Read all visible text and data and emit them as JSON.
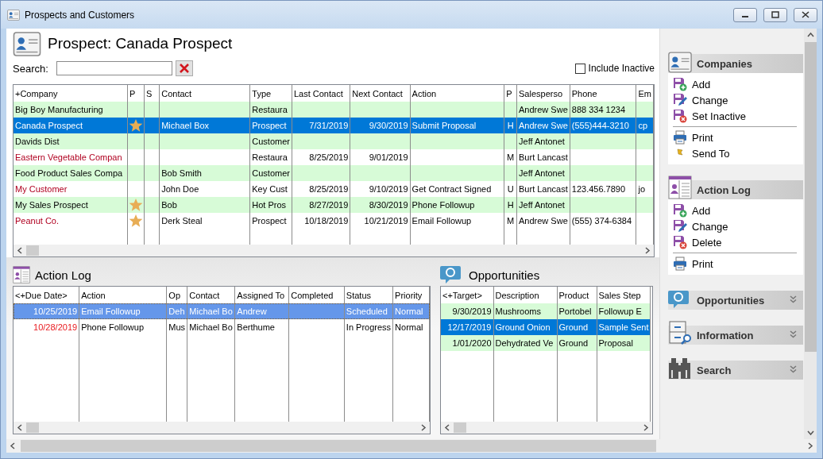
{
  "window": {
    "title": "Prospects and Customers"
  },
  "header": {
    "title": "Prospect: Canada Prospect"
  },
  "search": {
    "label": "Search:"
  },
  "include_inactive": {
    "label": "Include Inactive",
    "checked": false
  },
  "companies_grid": {
    "columns": [
      {
        "label": "+Company",
        "kind": "text"
      },
      {
        "label": "P",
        "kind": "star"
      },
      {
        "label": "S",
        "kind": "center"
      },
      {
        "label": "Contact",
        "kind": "text"
      },
      {
        "label": "Type",
        "kind": "text"
      },
      {
        "label": "Last Contact",
        "kind": "date"
      },
      {
        "label": "Next Contact",
        "kind": "date"
      },
      {
        "label": "Action",
        "kind": "text"
      },
      {
        "label": "P",
        "kind": "center"
      },
      {
        "label": "Salesperso",
        "kind": "text"
      },
      {
        "label": "Phone",
        "kind": "text"
      },
      {
        "label": "Em",
        "kind": "text"
      }
    ],
    "rows": [
      {
        "cells": [
          "Big Boy Manufacturing",
          null,
          null,
          null,
          "Restaura",
          null,
          null,
          null,
          null,
          "Andrew Swe",
          "888 334 1234",
          null
        ],
        "starred": false,
        "selected": false
      },
      {
        "cells": [
          "Canada Prospect",
          null,
          null,
          "Michael Box",
          "Prospect",
          "7/31/2019",
          "9/30/2019",
          "Submit Proposal",
          "H",
          "Andrew Swe",
          "(555)444-3210",
          "cp"
        ],
        "starred": true,
        "selected": true
      },
      {
        "cells": [
          "Davids Dist",
          null,
          null,
          null,
          "Customer",
          null,
          null,
          null,
          null,
          "Jeff Antonet",
          null,
          null
        ],
        "starred": false,
        "selected": false
      },
      {
        "cells": [
          "Eastern Vegetable Compan",
          null,
          null,
          null,
          "Restaura",
          "8/25/2019",
          "9/01/2019",
          null,
          "M",
          "Burt Lancast",
          null,
          null
        ],
        "starred": false,
        "selected": false,
        "color": "#b00020"
      },
      {
        "cells": [
          "Food Product Sales Compa",
          null,
          null,
          "Bob Smith",
          "Customer",
          null,
          null,
          null,
          null,
          "Jeff Antonet",
          null,
          null
        ],
        "starred": false,
        "selected": false
      },
      {
        "cells": [
          "My Customer",
          null,
          null,
          "John Doe",
          "Key Cust",
          "8/25/2019",
          "9/10/2019",
          "Get Contract Signed",
          "U",
          "Burt Lancast",
          "123.456.7890",
          "jo"
        ],
        "starred": false,
        "selected": false,
        "color": "#b00020"
      },
      {
        "cells": [
          "My Sales Prospect",
          null,
          null,
          "Bob",
          "Hot Pros",
          "8/27/2019",
          "8/30/2019",
          "Phone Followup",
          "H",
          "Jeff Antonet",
          null,
          null
        ],
        "starred": true,
        "selected": false
      },
      {
        "cells": [
          "Peanut Co.",
          null,
          null,
          "Derk Steal",
          "Prospect",
          "10/18/2019",
          "10/21/2019",
          "Email Followup",
          "M",
          "Andrew Swe",
          "(555) 374-6384",
          null
        ],
        "starred": true,
        "selected": false,
        "color": "#b00020"
      }
    ]
  },
  "action_log": {
    "title": "Action Log",
    "columns": [
      {
        "label": "<+Due Date>",
        "kind": "date"
      },
      {
        "label": "Action",
        "kind": "text"
      },
      {
        "label": "Op",
        "kind": "text"
      },
      {
        "label": "Contact",
        "kind": "text"
      },
      {
        "label": "Assigned To",
        "kind": "text"
      },
      {
        "label": "Completed",
        "kind": "text"
      },
      {
        "label": "Status",
        "kind": "text"
      },
      {
        "label": "Priority",
        "kind": "text"
      }
    ],
    "rows": [
      {
        "cells": [
          "10/25/2019",
          "Email Followup",
          "Deh",
          "Michael Bo",
          "Andrew",
          null,
          "Scheduled",
          "Normal"
        ],
        "selected": true,
        "overdue": false
      },
      {
        "cells": [
          "10/28/2019",
          "Phone Followup",
          "Mus",
          "Michael Bo",
          "Berthume",
          null,
          "In Progress",
          "Normal"
        ],
        "selected": false,
        "overdue": true
      }
    ]
  },
  "opportunities": {
    "title": "Opportunities",
    "columns": [
      {
        "label": "<+Target>",
        "kind": "date"
      },
      {
        "label": "Description",
        "kind": "text"
      },
      {
        "label": "Product",
        "kind": "text"
      },
      {
        "label": "Sales Step",
        "kind": "text"
      }
    ],
    "rows": [
      {
        "cells": [
          "9/30/2019",
          "Mushrooms",
          "Portobel",
          "Followup E"
        ],
        "selected": false
      },
      {
        "cells": [
          "12/17/2019",
          "Ground Onion",
          "Ground",
          "Sample Sent"
        ],
        "selected": true
      },
      {
        "cells": [
          "1/01/2020",
          "Dehydrated Ve",
          "Ground",
          "Proposal"
        ],
        "selected": false
      }
    ]
  },
  "side_panel": {
    "sections": [
      {
        "title": "Companies",
        "kind": "card",
        "expanded": true,
        "groups": [
          [
            {
              "label": "Add",
              "kind": "add"
            },
            {
              "label": "Change",
              "kind": "change"
            },
            {
              "label": "Set Inactive",
              "kind": "delete"
            }
          ],
          [
            {
              "label": "Print",
              "kind": "print"
            },
            {
              "label": "Send To",
              "kind": "send"
            }
          ]
        ]
      },
      {
        "title": "Action Log",
        "kind": "log",
        "expanded": true,
        "groups": [
          [
            {
              "label": "Add",
              "kind": "add"
            },
            {
              "label": "Change",
              "kind": "change"
            },
            {
              "label": "Delete",
              "kind": "delete"
            }
          ],
          [
            {
              "label": "Print",
              "kind": "print"
            }
          ]
        ]
      },
      {
        "title": "Opportunities",
        "kind": "money",
        "expanded": false
      },
      {
        "title": "Information",
        "kind": "info",
        "expanded": false
      },
      {
        "title": "Search",
        "kind": "binoculars",
        "expanded": false
      }
    ]
  }
}
